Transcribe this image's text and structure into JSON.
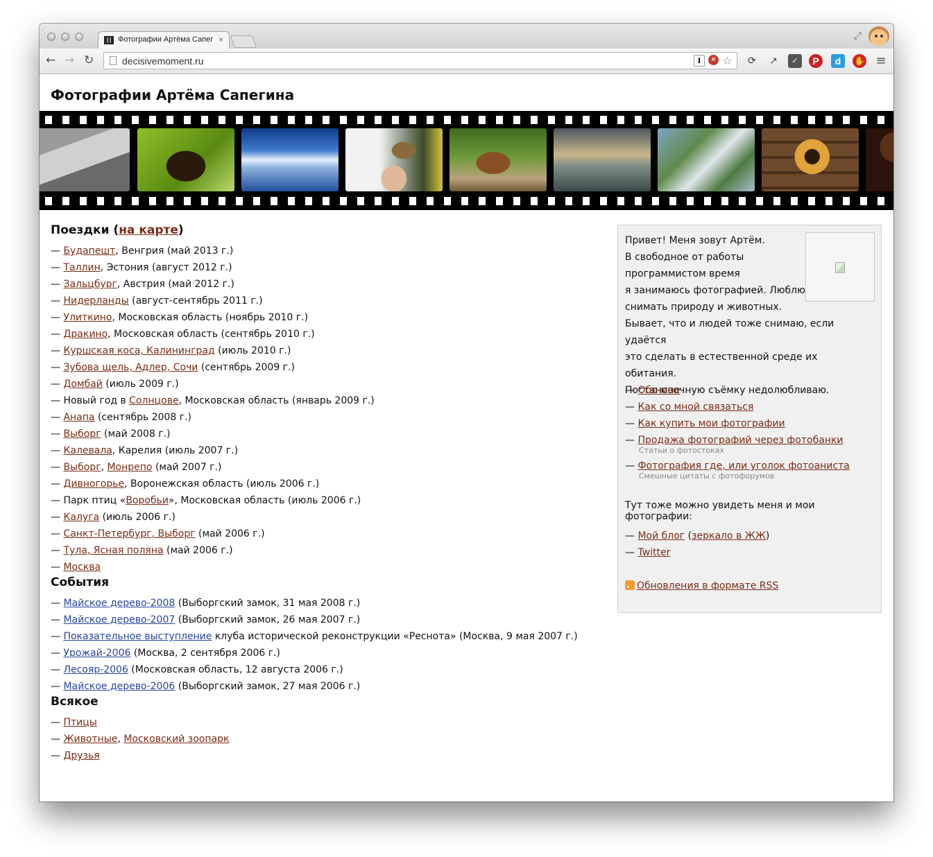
{
  "browser": {
    "tab_title": "Фотографии Артёма Сапегина",
    "tab_close": "×",
    "url": "decisivemoment.ru"
  },
  "site": {
    "title": "Фотографии Артёма Сапегина"
  },
  "filmstrip": {
    "frames": [
      "legs-photo",
      "beavers-photo",
      "sky-lake-photo",
      "bird-hand-photo",
      "horse-photo",
      "sea-shore-photo",
      "mountain-hiker-photo",
      "wooden-window-photo",
      "coffee-beans-photo"
    ]
  },
  "trips": {
    "heading_prefix": "Поездки (",
    "heading_link": "на карте",
    "heading_suffix": ")",
    "dash": "—",
    "items": [
      {
        "link": "Будапешт",
        "rest": ", Венгрия (май 2013 г.)"
      },
      {
        "link": "Таллин",
        "rest": ", Эстония (август 2012 г.)"
      },
      {
        "link": "Зальцбург",
        "rest": ", Австрия (май 2012 г.)"
      },
      {
        "link": "Нидерланды",
        "rest": " (август-сентябрь 2011 г.)"
      },
      {
        "link": "Улиткино",
        "rest": ", Московская область (ноябрь 2010 г.)"
      },
      {
        "link": "Дракино",
        "rest": ", Московская область (сентябрь 2010 г.)"
      },
      {
        "link": "Куршская коса, Калининград",
        "rest": " (июль 2010 г.)"
      },
      {
        "link": "Зубова щель, Адлер, Сочи",
        "rest": " (сентябрь 2009 г.)"
      },
      {
        "link": "Домбай",
        "rest": " (июль 2009 г.)"
      },
      {
        "before": "Новый год в ",
        "link": "Солнцове",
        "rest": ", Московская область (январь 2009 г.)"
      },
      {
        "link": "Анапа",
        "rest": " (сентябрь 2008 г.)"
      },
      {
        "link": "Выборг",
        "rest": " (май 2008 г.)"
      },
      {
        "link": "Калевала",
        "rest": ", Карелия (июль 2007 г.)"
      },
      {
        "link": "Выборг",
        "mid": ", ",
        "link2": "Монрепо",
        "rest": " (май 2007 г.)"
      },
      {
        "link": "Дивногорье",
        "rest": ", Воронежская область (июль 2006 г.)"
      },
      {
        "before": "Парк птиц «",
        "link": "Воробьи",
        "rest": "», Московская область (июль 2006 г.)"
      },
      {
        "link": "Калуга",
        "rest": " (июль 2006 г.)"
      },
      {
        "link": "Санкт-Петербург, Выборг",
        "rest": " (май 2006 г.)"
      },
      {
        "link": "Тула, Ясная поляна",
        "rest": " (май 2006 г.)"
      },
      {
        "link": "Москва",
        "rest": ""
      }
    ]
  },
  "events": {
    "heading": "События",
    "items": [
      {
        "link": "Майское дерево-2008",
        "rest": " (Выборгский замок, 31 мая 2008 г.)"
      },
      {
        "link": "Майское дерево-2007",
        "rest": " (Выборгский замок, 26 мая 2007 г.)"
      },
      {
        "link": "Показательное выступление",
        "rest": " клуба исторической реконструкции «Реснота» (Москва, 9 мая 2007  г.)"
      },
      {
        "link": "Урожай-2006",
        "rest": " (Москва, 2 сентября 2006 г.)"
      },
      {
        "link": "Лесояр-2006",
        "rest": " (Московская область, 12 августа 2006 г.)"
      },
      {
        "link": "Майское дерево-2006",
        "rest": " (Выборгский замок, 27 мая 2006 г.)"
      }
    ]
  },
  "misc": {
    "heading": "Всякое",
    "items": [
      {
        "link": "Птицы",
        "rest": ""
      },
      {
        "link": "Животные",
        "mid": ", ",
        "link2": "Московский зоопарк",
        "rest": ""
      },
      {
        "link": "Друзья",
        "rest": ""
      }
    ]
  },
  "sidebar": {
    "intro_lines": [
      "Привет! Меня зовут Артём.",
      "В свободное от работы",
      "программистом время",
      "я занимаюсь фотографией. Люблю",
      "снимать природу и животных.",
      "Бывает, что и людей тоже снимаю, если удаётся",
      "это сделать в естественной среде их обитания.",
      "Постановочную съёмку недолюбливаю."
    ],
    "links": [
      {
        "label": "Обо мне"
      },
      {
        "label": "Как со мной связаться"
      },
      {
        "label": "Как купить мои фотографии"
      },
      {
        "label": "Продажа фотографий через фотобанки",
        "sub": "Статьи о фотостоках"
      },
      {
        "label": "Фотография где, или уголок фотоаниста",
        "sub": "Смешные цитаты с фотофорумов"
      }
    ],
    "also_text": "Тут тоже можно увидеть меня и мои фотографии:",
    "blog_label": "Мой блог",
    "blog_open": " (",
    "mirror_label": "зеркало в ЖЖ",
    "blog_close": ")",
    "twitter_label": "Twitter",
    "rss_label": "Обновления в формате RSS"
  },
  "colors": {
    "link": "#7a2b14",
    "event_link": "#2844a0",
    "sidebar_bg": "#f0f0f0"
  }
}
